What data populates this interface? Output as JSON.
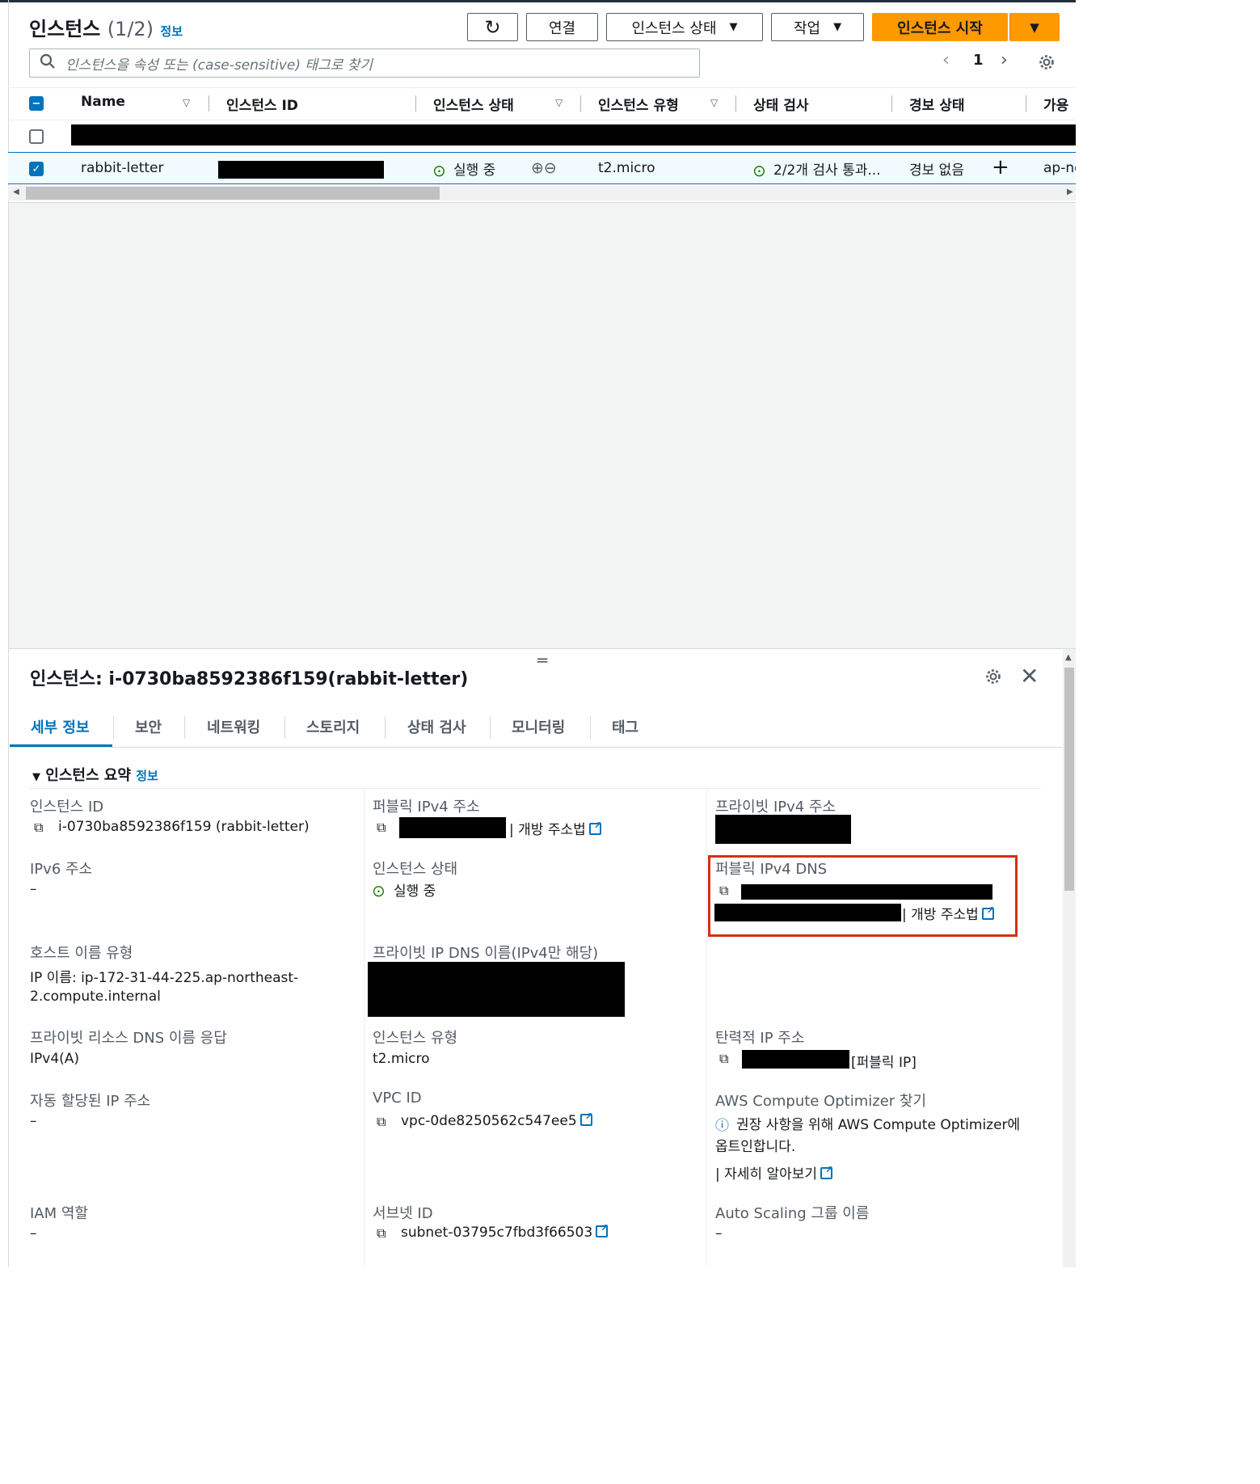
{
  "header": {
    "title": "인스턴스",
    "count": "(1/2)",
    "info": "정보",
    "refresh_icon": "refresh-icon",
    "connect": "연결",
    "instance_state": "인스턴스 상태",
    "actions": "작업",
    "launch": "인스턴스 시작",
    "search_placeholder": "인스턴스을 속성 또는 (case-sensitive) 태그로 찾기",
    "page": "1"
  },
  "table": {
    "columns": [
      "Name",
      "인스턴스 ID",
      "인스턴스 상태",
      "인스턴스 유형",
      "상태 검사",
      "경보 상태",
      "가용"
    ],
    "row": {
      "name": "rabbit-letter",
      "state": "실행 중",
      "type": "t2.micro",
      "check": "2/2개 검사 통과...",
      "alarm": "경보 없음",
      "az": "ap-ne"
    }
  },
  "panel": {
    "title": "인스턴스: i-0730ba8592386f159(rabbit-letter)",
    "tabs": [
      "세부 정보",
      "보안",
      "네트워킹",
      "스토리지",
      "상태 검사",
      "모니터링",
      "태그"
    ],
    "section": "인스턴스 요약",
    "section_info": "정보",
    "instance_id_label": "인스턴스 ID",
    "instance_id_value": "i-0730ba8592386f159 (rabbit-letter)",
    "public_ipv4_label": "퍼블릭 IPv4 주소",
    "open_address": "개방 주소법",
    "private_ipv4_label": "프라이빗 IPv4 주소",
    "ipv6_label": "IPv6 주소",
    "ipv6_value": "–",
    "state_label": "인스턴스 상태",
    "state_value": "실행 중",
    "public_dns_label": "퍼블릭 IPv4 DNS",
    "host_type_label": "호스트 이름 유형",
    "host_type_value_1": "IP 이름: ip-172-31-44-225.ap-northeast-",
    "host_type_value_2": "2.compute.internal",
    "private_dns_label": "프라이빗 IP DNS 이름(IPv4만 해당)",
    "resource_dns_label": "프라이빗 리소스 DNS 이름 응답",
    "resource_dns_value": "IPv4(A)",
    "type_label": "인스턴스 유형",
    "type_value": "t2.micro",
    "elastic_label": "탄력적 IP 주소",
    "elastic_suffix": "[퍼블릭 IP]",
    "auto_ip_label": "자동 할당된 IP 주소",
    "auto_ip_value": "–",
    "vpc_label": "VPC ID",
    "vpc_value": "vpc-0de8250562c547ee5",
    "optimizer_label": "AWS Compute Optimizer 찾기",
    "optimizer_text_1": "권장 사항을 위해 AWS Compute Optimizer에",
    "optimizer_text_2": "옵트인합니다.",
    "learn_more": "자세히 알아보기",
    "iam_label": "IAM 역할",
    "iam_value": "–",
    "subnet_label": "서브넷 ID",
    "subnet_value": "subnet-03795c7fbd3f66503",
    "asg_label": "Auto Scaling 그룹 이름",
    "asg_value": "–"
  },
  "colors": {
    "accent": "#0073bb",
    "primary": "#ff9900",
    "success": "#1d8102",
    "highlight": "#d13212"
  }
}
